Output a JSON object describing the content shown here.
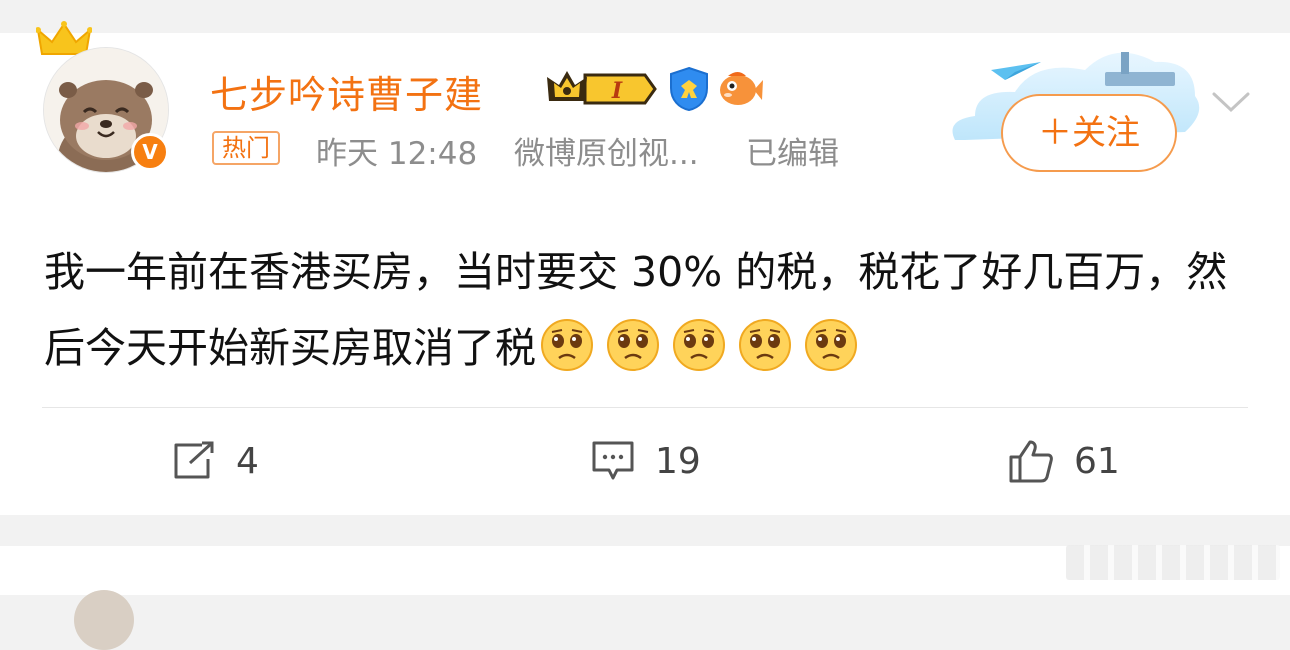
{
  "post": {
    "username": "七步吟诗曹子建",
    "hot_tag": "热门",
    "time": "昨天 12:48",
    "source": "微博原创视...",
    "edited": "已编辑",
    "follow_label": "＋关注",
    "text": "我一年前在香港买房，当时要交 30% 的税，税花了好几百万，然后今天开始新买房取消了税",
    "emoji_name": "crying-face-emoji",
    "verified_mark": "V",
    "badge_level": "I"
  },
  "actions": {
    "repost_count": "4",
    "comment_count": "19",
    "like_count": "61"
  },
  "colors": {
    "accent": "#f37212",
    "meta_text": "#8d8d8d",
    "body_text": "#111111",
    "background": "#f2f2f2"
  }
}
